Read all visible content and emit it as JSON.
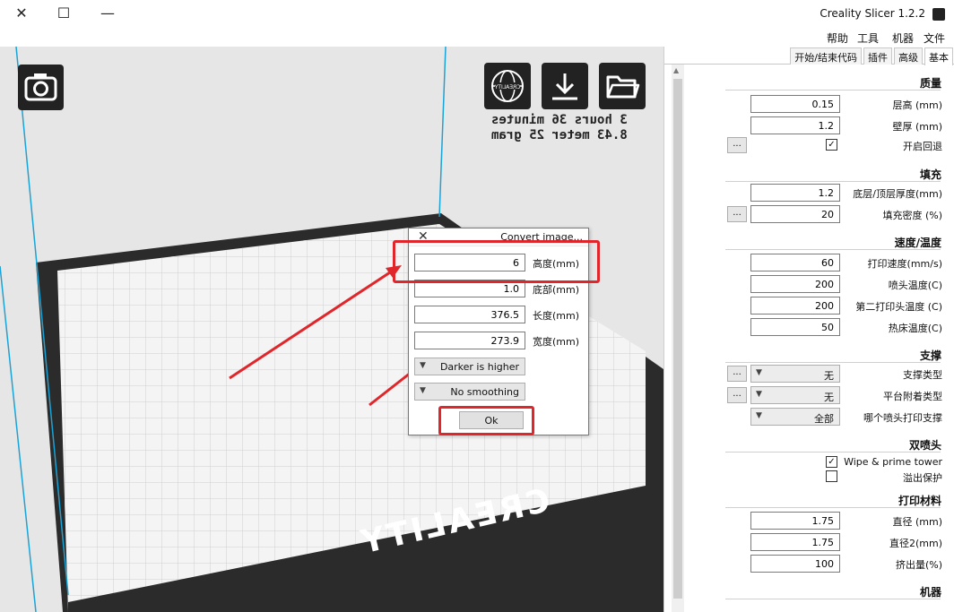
{
  "window": {
    "title": "Creality Slicer 1.2.2",
    "controls": [
      "close-icon",
      "maximize-icon",
      "minimize-icon"
    ]
  },
  "menu": [
    "文件",
    "机器",
    "工具",
    "帮助"
  ],
  "viewport": {
    "print_time": "3 hours 36 minutes",
    "print_material": "8.43 meter 25 gram",
    "bed_logo": "CREALITY"
  },
  "dialog": {
    "title": "Convert image...",
    "height_label": "高度(mm)",
    "height_value": "6",
    "base_label": "底部(mm)",
    "base_value": "1.0",
    "length_label": "长度(mm)",
    "length_value": "376.5",
    "width_label": "宽度(mm)",
    "width_value": "273.9",
    "mode_select": "Darker is higher",
    "smoothing_select": "No smoothing",
    "ok_label": "Ok"
  },
  "tabs": [
    "基本",
    "高级",
    "插件",
    "开始/结束代码"
  ],
  "sections": {
    "quality": {
      "title": "质量",
      "layer_height_label": "层高 (mm)",
      "layer_height": "0.15",
      "wall_thickness_label": "壁厚 (mm)",
      "wall_thickness": "1.2",
      "retraction_label": "开启回退",
      "retraction_checked": "✓"
    },
    "fill": {
      "title": "填充",
      "bottom_top_label": "底层/顶层厚度(mm)",
      "bottom_top": "1.2",
      "density_label": "填充密度 (%)",
      "density": "20"
    },
    "speed": {
      "title": "速度/温度",
      "print_speed_label": "打印速度(mm/s)",
      "print_speed": "60",
      "nozzle_temp_label": "喷头温度(C)",
      "nozzle_temp": "200",
      "nozzle2_temp_label": "第二打印头温度 (C)",
      "nozzle2_temp": "200",
      "bed_temp_label": "热床温度(C)",
      "bed_temp": "50"
    },
    "support": {
      "title": "支撑",
      "support_type_label": "支撑类型",
      "support_type": "无",
      "adhesion_label": "平台附着类型",
      "adhesion": "无",
      "extruder_label": "哪个喷头打印支撑",
      "extruder": "全部"
    },
    "dual": {
      "title": "双喷头",
      "wipe_label": "Wipe & prime tower",
      "wipe_checked": "✓",
      "ooze_label": "溢出保护"
    },
    "filament": {
      "title": "打印材料",
      "diameter_label": "直径 (mm)",
      "diameter": "1.75",
      "diameter2_label": "直径2(mm)",
      "diameter2": "1.75",
      "flow_label": "挤出量(%)",
      "flow": "100"
    },
    "machine": {
      "title": "机器"
    }
  },
  "colors": {
    "highlight": "#e0262b",
    "frame_line": "#1aa3d6",
    "bed_border": "#2b2b2b",
    "bed_surface": "#f4f4f4"
  }
}
